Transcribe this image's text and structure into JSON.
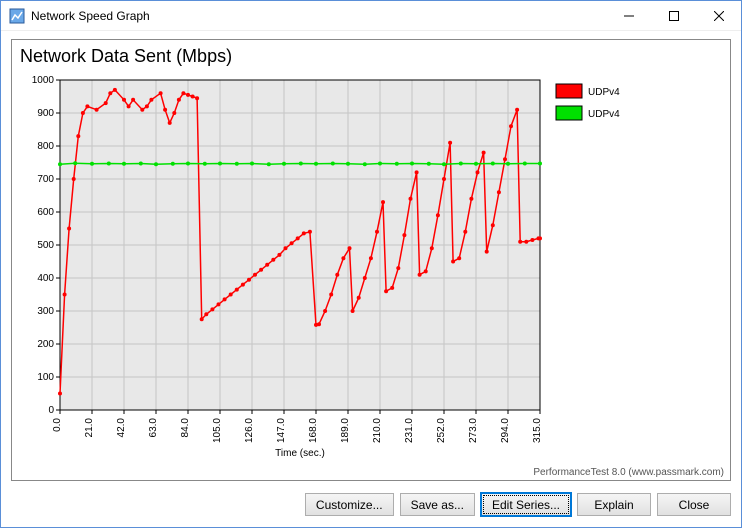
{
  "window": {
    "title": "Network Speed Graph",
    "icon_alt": "app-icon"
  },
  "chart_data": {
    "type": "line",
    "title": "Network Data Sent (Mbps)",
    "xlabel": "Time (sec.)",
    "ylabel": "",
    "xlim": [
      0,
      315
    ],
    "ylim": [
      0,
      1000
    ],
    "xticks": [
      0.0,
      21.0,
      42.0,
      63.0,
      84.0,
      105.0,
      126.0,
      147.0,
      168.0,
      189.0,
      210.0,
      231.0,
      252.0,
      273.0,
      294.0,
      315.0
    ],
    "yticks": [
      0,
      100,
      200,
      300,
      400,
      500,
      600,
      700,
      800,
      900,
      1000
    ],
    "legend_position": "right",
    "series": [
      {
        "name": "UDPv4",
        "color": "#ff0000",
        "x": [
          0,
          3,
          6,
          9,
          12,
          15,
          18,
          24,
          30,
          33,
          36,
          42,
          45,
          48,
          54,
          57,
          60,
          66,
          69,
          72,
          75,
          78,
          81,
          84,
          87,
          90,
          93,
          96,
          100,
          104,
          108,
          112,
          116,
          120,
          124,
          128,
          132,
          136,
          140,
          144,
          148,
          152,
          156,
          160,
          164,
          168,
          170,
          174,
          178,
          182,
          186,
          190,
          192,
          196,
          200,
          204,
          208,
          212,
          214,
          218,
          222,
          226,
          230,
          234,
          236,
          240,
          244,
          248,
          252,
          256,
          258,
          262,
          266,
          270,
          274,
          278,
          280,
          284,
          288,
          292,
          296,
          300,
          302,
          306,
          310,
          314,
          315
        ],
        "values": [
          50,
          350,
          550,
          700,
          830,
          900,
          920,
          910,
          930,
          960,
          970,
          940,
          920,
          940,
          910,
          920,
          940,
          960,
          910,
          870,
          900,
          940,
          960,
          955,
          950,
          945,
          275,
          290,
          305,
          320,
          335,
          350,
          365,
          380,
          395,
          410,
          425,
          440,
          455,
          470,
          490,
          505,
          520,
          535,
          540,
          258,
          260,
          300,
          350,
          410,
          460,
          490,
          300,
          340,
          400,
          460,
          540,
          630,
          360,
          370,
          430,
          530,
          640,
          720,
          410,
          420,
          490,
          590,
          700,
          810,
          450,
          460,
          540,
          640,
          720,
          780,
          480,
          560,
          660,
          760,
          860,
          910,
          510,
          510,
          515,
          520,
          520
        ]
      },
      {
        "name": "UDPv4",
        "color": "#00e000",
        "x": [
          0,
          10,
          21,
          32,
          42,
          53,
          63,
          74,
          84,
          95,
          105,
          116,
          126,
          137,
          147,
          158,
          168,
          179,
          189,
          200,
          210,
          221,
          231,
          242,
          252,
          263,
          273,
          284,
          294,
          305,
          315
        ],
        "values": [
          745,
          748,
          746,
          747,
          746,
          747,
          745,
          746,
          747,
          746,
          747,
          746,
          747,
          745,
          746,
          747,
          746,
          747,
          746,
          745,
          747,
          746,
          747,
          746,
          745,
          747,
          746,
          747,
          746,
          747,
          747
        ]
      }
    ]
  },
  "footer": {
    "brand": "PerformanceTest 8.0 (www.passmark.com)"
  },
  "buttons": {
    "customize": "Customize...",
    "saveas": "Save as...",
    "editseries": "Edit Series...",
    "explain": "Explain",
    "close": "Close"
  }
}
